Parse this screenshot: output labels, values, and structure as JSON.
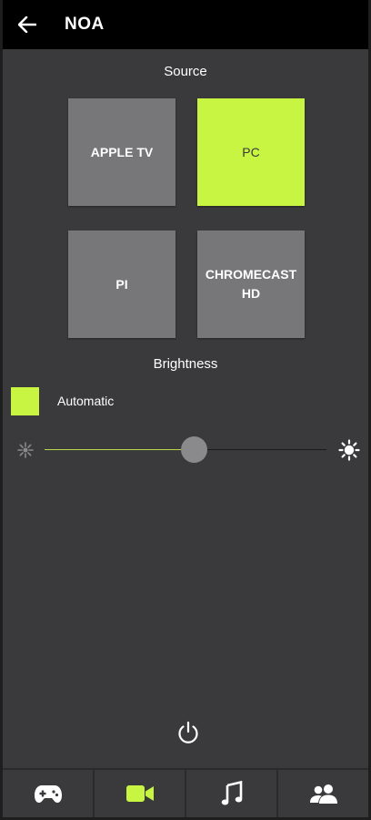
{
  "header": {
    "title": "NOA",
    "back_icon": "arrow-left-icon"
  },
  "source": {
    "title": "Source",
    "tiles": [
      {
        "label": "APPLE TV",
        "active": false
      },
      {
        "label": "PC",
        "active": true
      },
      {
        "label": "PI",
        "active": false
      },
      {
        "label": "CHROMECAST HD",
        "active": false
      }
    ]
  },
  "brightness": {
    "title": "Brightness",
    "automatic_label": "Automatic",
    "automatic_checked": true,
    "slider_value": 0.53
  },
  "bottom_nav": [
    {
      "icon": "gamepad-icon",
      "active": false
    },
    {
      "icon": "video-camera-icon",
      "active": true
    },
    {
      "icon": "music-note-icon",
      "active": false
    },
    {
      "icon": "users-icon",
      "active": false
    }
  ],
  "colors": {
    "accent": "#c8f542",
    "background": "#3a3a3c",
    "tile": "#77777a",
    "header": "#000000"
  }
}
